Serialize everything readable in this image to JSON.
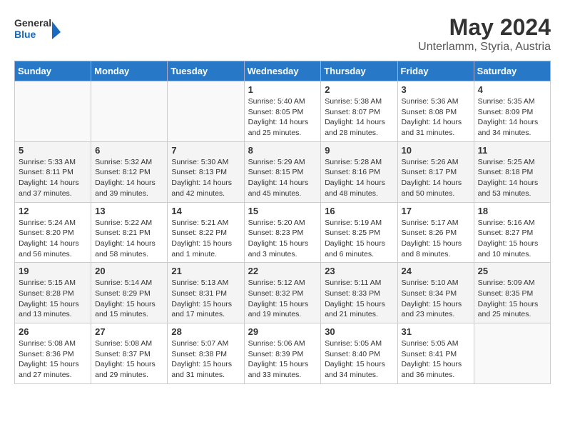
{
  "header": {
    "logo_line1": "General",
    "logo_line2": "Blue",
    "main_title": "May 2024",
    "subtitle": "Unterlamm, Styria, Austria"
  },
  "weekdays": [
    "Sunday",
    "Monday",
    "Tuesday",
    "Wednesday",
    "Thursday",
    "Friday",
    "Saturday"
  ],
  "weeks": [
    [
      {
        "day": "",
        "info": ""
      },
      {
        "day": "",
        "info": ""
      },
      {
        "day": "",
        "info": ""
      },
      {
        "day": "1",
        "info": "Sunrise: 5:40 AM\nSunset: 8:05 PM\nDaylight: 14 hours\nand 25 minutes."
      },
      {
        "day": "2",
        "info": "Sunrise: 5:38 AM\nSunset: 8:07 PM\nDaylight: 14 hours\nand 28 minutes."
      },
      {
        "day": "3",
        "info": "Sunrise: 5:36 AM\nSunset: 8:08 PM\nDaylight: 14 hours\nand 31 minutes."
      },
      {
        "day": "4",
        "info": "Sunrise: 5:35 AM\nSunset: 8:09 PM\nDaylight: 14 hours\nand 34 minutes."
      }
    ],
    [
      {
        "day": "5",
        "info": "Sunrise: 5:33 AM\nSunset: 8:11 PM\nDaylight: 14 hours\nand 37 minutes."
      },
      {
        "day": "6",
        "info": "Sunrise: 5:32 AM\nSunset: 8:12 PM\nDaylight: 14 hours\nand 39 minutes."
      },
      {
        "day": "7",
        "info": "Sunrise: 5:30 AM\nSunset: 8:13 PM\nDaylight: 14 hours\nand 42 minutes."
      },
      {
        "day": "8",
        "info": "Sunrise: 5:29 AM\nSunset: 8:15 PM\nDaylight: 14 hours\nand 45 minutes."
      },
      {
        "day": "9",
        "info": "Sunrise: 5:28 AM\nSunset: 8:16 PM\nDaylight: 14 hours\nand 48 minutes."
      },
      {
        "day": "10",
        "info": "Sunrise: 5:26 AM\nSunset: 8:17 PM\nDaylight: 14 hours\nand 50 minutes."
      },
      {
        "day": "11",
        "info": "Sunrise: 5:25 AM\nSunset: 8:18 PM\nDaylight: 14 hours\nand 53 minutes."
      }
    ],
    [
      {
        "day": "12",
        "info": "Sunrise: 5:24 AM\nSunset: 8:20 PM\nDaylight: 14 hours\nand 56 minutes."
      },
      {
        "day": "13",
        "info": "Sunrise: 5:22 AM\nSunset: 8:21 PM\nDaylight: 14 hours\nand 58 minutes."
      },
      {
        "day": "14",
        "info": "Sunrise: 5:21 AM\nSunset: 8:22 PM\nDaylight: 15 hours\nand 1 minute."
      },
      {
        "day": "15",
        "info": "Sunrise: 5:20 AM\nSunset: 8:23 PM\nDaylight: 15 hours\nand 3 minutes."
      },
      {
        "day": "16",
        "info": "Sunrise: 5:19 AM\nSunset: 8:25 PM\nDaylight: 15 hours\nand 6 minutes."
      },
      {
        "day": "17",
        "info": "Sunrise: 5:17 AM\nSunset: 8:26 PM\nDaylight: 15 hours\nand 8 minutes."
      },
      {
        "day": "18",
        "info": "Sunrise: 5:16 AM\nSunset: 8:27 PM\nDaylight: 15 hours\nand 10 minutes."
      }
    ],
    [
      {
        "day": "19",
        "info": "Sunrise: 5:15 AM\nSunset: 8:28 PM\nDaylight: 15 hours\nand 13 minutes."
      },
      {
        "day": "20",
        "info": "Sunrise: 5:14 AM\nSunset: 8:29 PM\nDaylight: 15 hours\nand 15 minutes."
      },
      {
        "day": "21",
        "info": "Sunrise: 5:13 AM\nSunset: 8:31 PM\nDaylight: 15 hours\nand 17 minutes."
      },
      {
        "day": "22",
        "info": "Sunrise: 5:12 AM\nSunset: 8:32 PM\nDaylight: 15 hours\nand 19 minutes."
      },
      {
        "day": "23",
        "info": "Sunrise: 5:11 AM\nSunset: 8:33 PM\nDaylight: 15 hours\nand 21 minutes."
      },
      {
        "day": "24",
        "info": "Sunrise: 5:10 AM\nSunset: 8:34 PM\nDaylight: 15 hours\nand 23 minutes."
      },
      {
        "day": "25",
        "info": "Sunrise: 5:09 AM\nSunset: 8:35 PM\nDaylight: 15 hours\nand 25 minutes."
      }
    ],
    [
      {
        "day": "26",
        "info": "Sunrise: 5:08 AM\nSunset: 8:36 PM\nDaylight: 15 hours\nand 27 minutes."
      },
      {
        "day": "27",
        "info": "Sunrise: 5:08 AM\nSunset: 8:37 PM\nDaylight: 15 hours\nand 29 minutes."
      },
      {
        "day": "28",
        "info": "Sunrise: 5:07 AM\nSunset: 8:38 PM\nDaylight: 15 hours\nand 31 minutes."
      },
      {
        "day": "29",
        "info": "Sunrise: 5:06 AM\nSunset: 8:39 PM\nDaylight: 15 hours\nand 33 minutes."
      },
      {
        "day": "30",
        "info": "Sunrise: 5:05 AM\nSunset: 8:40 PM\nDaylight: 15 hours\nand 34 minutes."
      },
      {
        "day": "31",
        "info": "Sunrise: 5:05 AM\nSunset: 8:41 PM\nDaylight: 15 hours\nand 36 minutes."
      },
      {
        "day": "",
        "info": ""
      }
    ]
  ]
}
